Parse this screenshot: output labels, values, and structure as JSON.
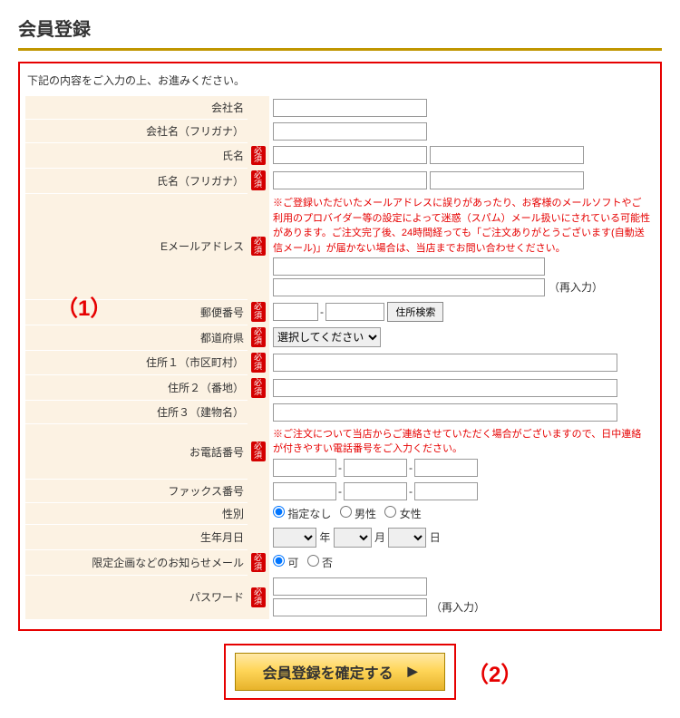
{
  "page": {
    "title": "会員登録",
    "instruction": "下記の内容をご入力の上、お進みください。",
    "required_badge": "必須",
    "zip_search_btn": "住所検索",
    "reenter_hint": "（再入力）",
    "callout1": "（1）",
    "callout2": "（2）",
    "submit_label": "会員登録を確定する",
    "arrow": "▶"
  },
  "fields": {
    "company": {
      "label": "会社名"
    },
    "company_kana": {
      "label": "会社名（フリガナ）"
    },
    "name": {
      "label": "氏名"
    },
    "name_kana": {
      "label": "氏名（フリガナ）"
    },
    "email": {
      "label": "Eメールアドレス",
      "note": "※ご登録いただいたメールアドレスに誤りがあったり、お客様のメールソフトやご利用のプロバイダー等の設定によって迷惑（スパム）メール扱いにされている可能性があります。ご注文完了後、24時間経っても「ご注文ありがとうございます(自動送信メール)」が届かない場合は、当店までお問い合わせください。"
    },
    "zip": {
      "label": "郵便番号"
    },
    "pref": {
      "label": "都道府県",
      "placeholder": "選択してください"
    },
    "addr1": {
      "label": "住所１（市区町村）"
    },
    "addr2": {
      "label": "住所２（番地）"
    },
    "addr3": {
      "label": "住所３（建物名）"
    },
    "tel": {
      "label": "お電話番号",
      "note": "※ご注文について当店からご連絡させていただく場合がございますので、日中連絡が付きやすい電話番号をご入力ください。"
    },
    "fax": {
      "label": "ファックス番号"
    },
    "sex": {
      "label": "性別",
      "opt_none": "指定なし",
      "opt_m": "男性",
      "opt_f": "女性"
    },
    "birth": {
      "label": "生年月日",
      "y": "年",
      "m": "月",
      "d": "日"
    },
    "newsletter": {
      "label": "限定企画などのお知らせメール",
      "opt_yes": "可",
      "opt_no": "否"
    },
    "password": {
      "label": "パスワード"
    }
  }
}
